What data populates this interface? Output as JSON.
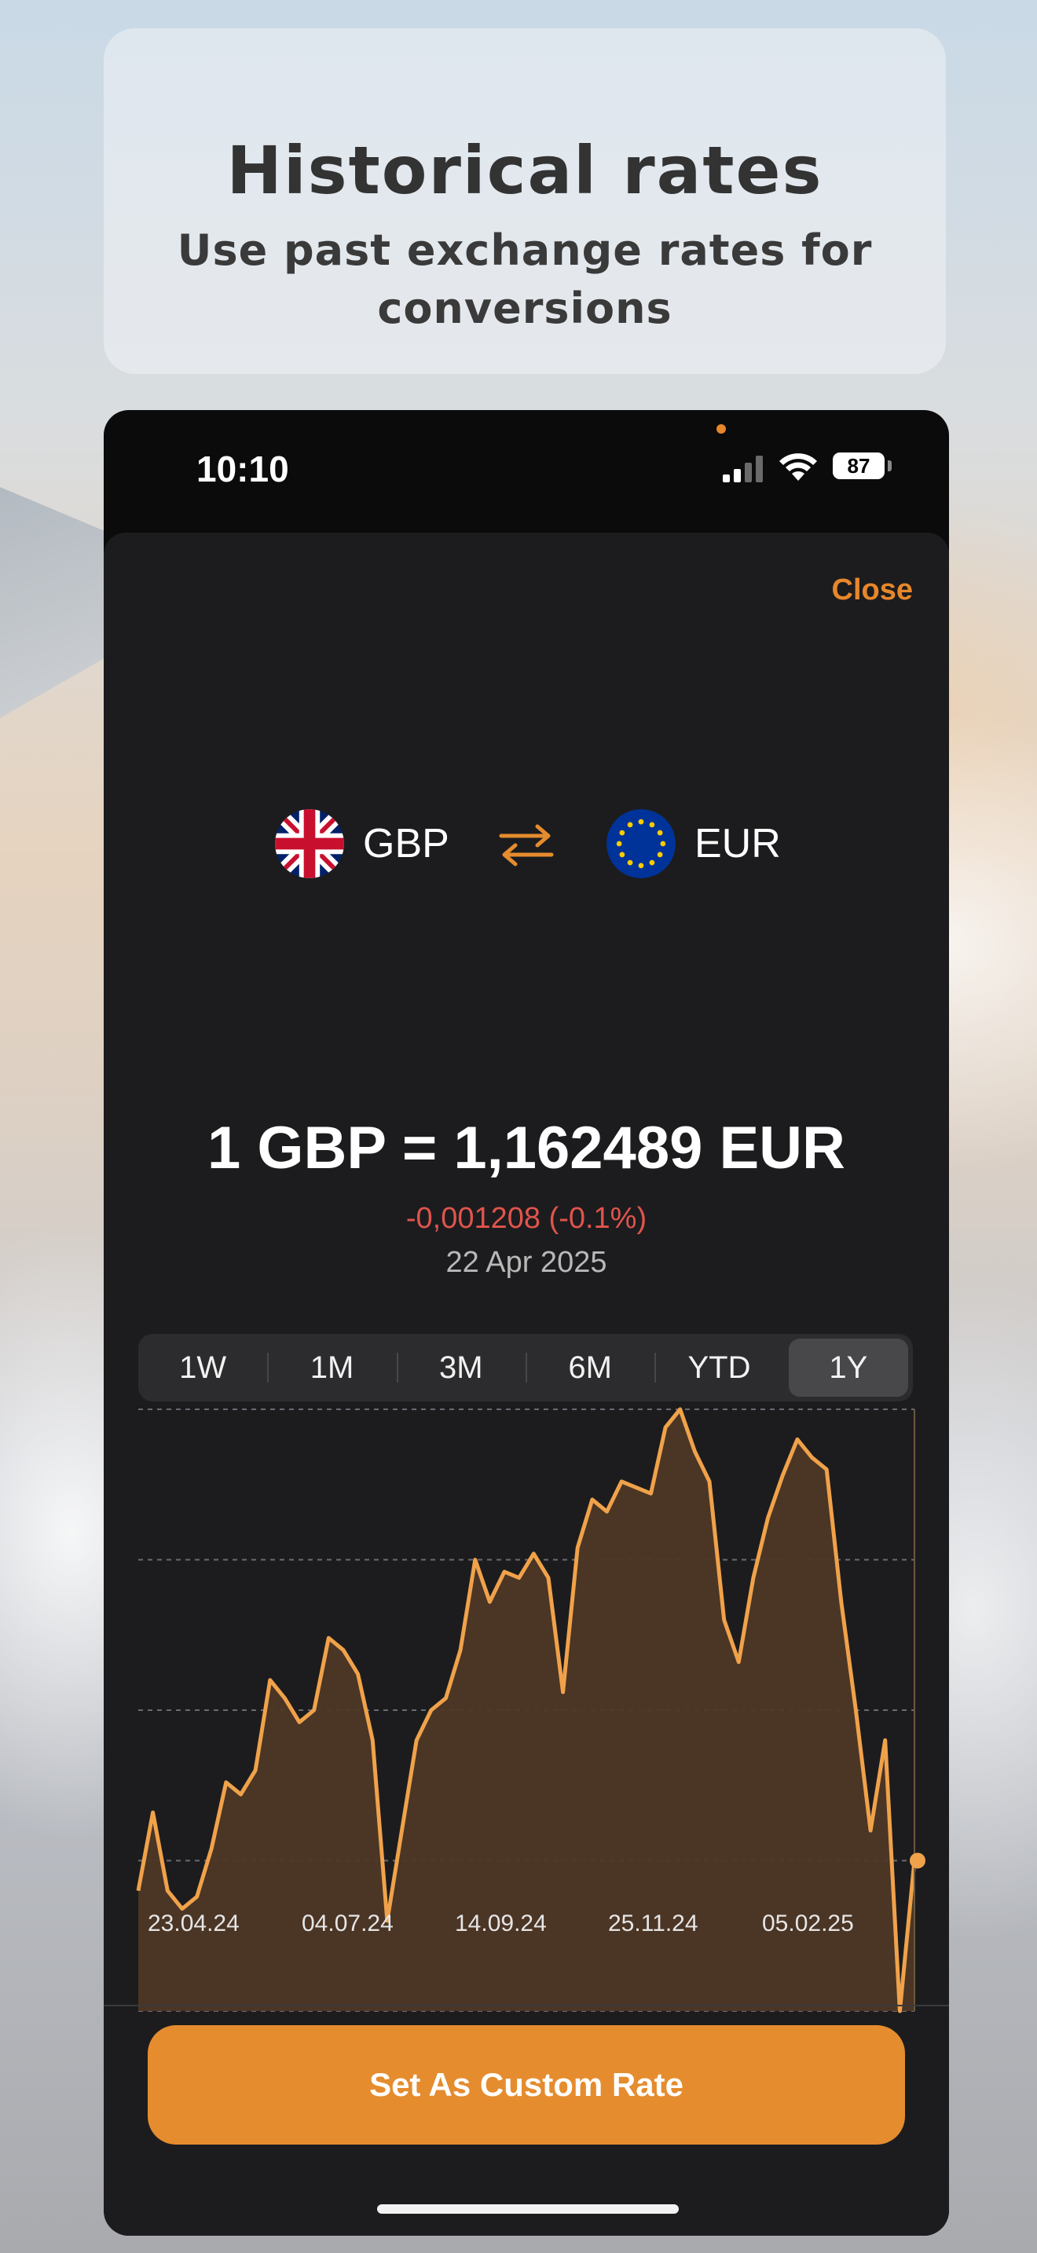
{
  "header": {
    "title": "Historical rates",
    "subtitle": "Use past exchange rates for conversions"
  },
  "status_bar": {
    "time": "10:10",
    "battery": "87"
  },
  "sheet": {
    "close_label": "Close",
    "from_currency": {
      "code": "GBP",
      "flag_icon": "uk-flag-icon"
    },
    "to_currency": {
      "code": "EUR",
      "flag_icon": "eu-flag-icon"
    },
    "swap_icon": "swap-arrows-icon",
    "rate_text": "1 GBP = 1,162489 EUR",
    "change_text": "-0,001208 (-0.1%)",
    "date_text": "22 Apr 2025",
    "ranges": [
      {
        "label": "1W",
        "active": false
      },
      {
        "label": "1M",
        "active": false
      },
      {
        "label": "3M",
        "active": false
      },
      {
        "label": "6M",
        "active": false
      },
      {
        "label": "YTD",
        "active": false
      },
      {
        "label": "1Y",
        "active": true
      }
    ],
    "cta_label": "Set As Custom Rate"
  },
  "colors": {
    "accent": "#e58c2e",
    "line": "#f0a24a",
    "fill": "#4e3726",
    "negative": "#e0544c",
    "sheet_bg": "#1c1c1e"
  },
  "chart_data": {
    "type": "area",
    "x_tick_labels": [
      "23.04.24",
      "04.07.24",
      "14.09.24",
      "25.11.24",
      "05.02.25"
    ],
    "grid": "horizontal-dashed",
    "series": [
      {
        "values": [
          0.2,
          0.33,
          0.2,
          0.17,
          0.19,
          0.27,
          0.38,
          0.36,
          0.4,
          0.55,
          0.52,
          0.48,
          0.5,
          0.62,
          0.6,
          0.56,
          0.45,
          0.15,
          0.3,
          0.45,
          0.5,
          0.52,
          0.6,
          0.75,
          0.68,
          0.73,
          0.72,
          0.76,
          0.72,
          0.53,
          0.77,
          0.85,
          0.83,
          0.88,
          0.87,
          0.86,
          0.97,
          1.0,
          0.93,
          0.88,
          0.65,
          0.58,
          0.72,
          0.82,
          0.89,
          0.95,
          0.92,
          0.9,
          0.68,
          0.5,
          0.3,
          0.45,
          0.0,
          0.25
        ]
      }
    ]
  }
}
